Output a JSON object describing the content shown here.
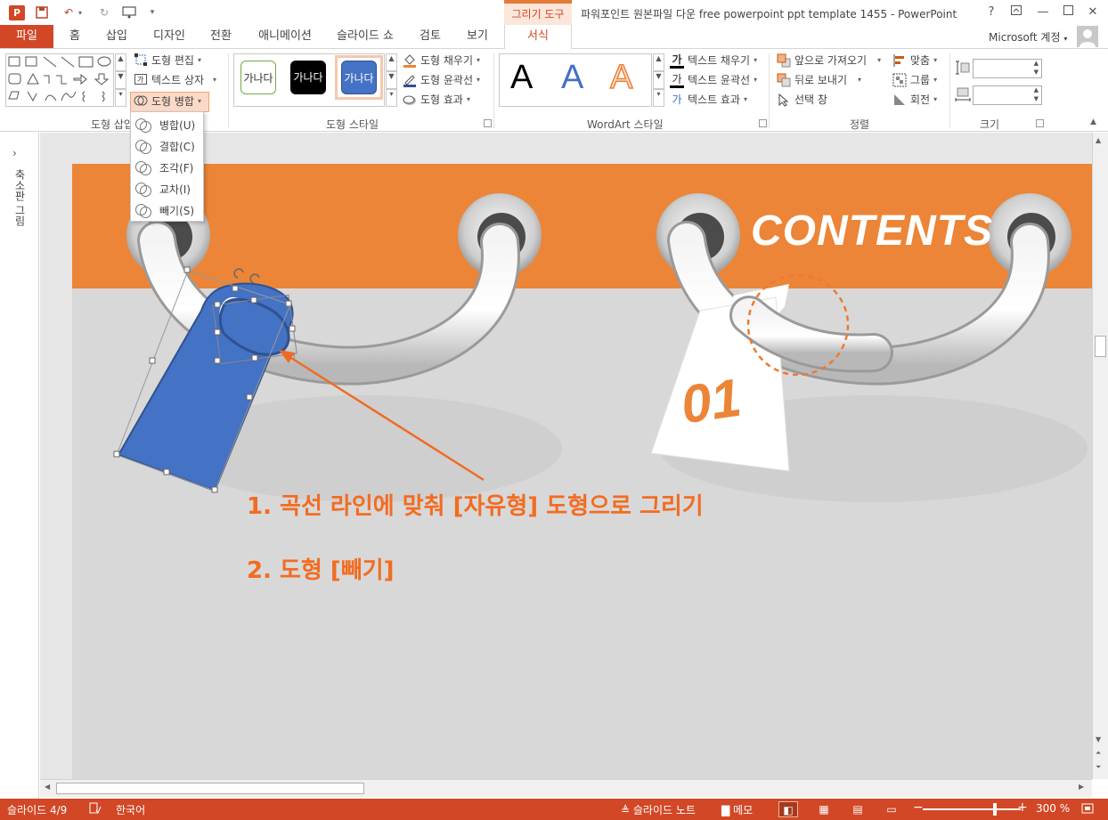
{
  "window": {
    "title": "파워포인트 원본파일 다운 free powerpoint ppt template 1455 - PowerPoint",
    "contextual_group": "그리기 도구",
    "help": "?",
    "account": "Microsoft 계정"
  },
  "tabs": {
    "file": "파일",
    "items": [
      "홈",
      "삽입",
      "디자인",
      "전환",
      "애니메이션",
      "슬라이드 쇼",
      "검토",
      "보기"
    ],
    "format": "서식"
  },
  "ribbon": {
    "insert_shapes": {
      "label": "도형 삽입",
      "edit_shape": "도형 편집",
      "text_box": "텍스트 상자",
      "merge_shapes": "도형 병합"
    },
    "shape_styles": {
      "label": "도형 스타일",
      "samples": [
        "가나다",
        "가나다",
        "가나다"
      ],
      "fill": "도형 채우기",
      "outline": "도형 윤곽선",
      "effects": "도형 효과"
    },
    "wordart": {
      "label": "WordArt 스타일",
      "samples": [
        "A",
        "A",
        "A"
      ],
      "text_fill": "텍스트 채우기",
      "text_outline": "텍스트 윤곽선",
      "text_effects": "텍스트 효과"
    },
    "arrange": {
      "label": "정렬",
      "bring_forward": "앞으로 가져오기",
      "send_backward": "뒤로 보내기",
      "selection_pane": "선택 창",
      "align": "맞춤",
      "group": "그룹",
      "rotate": "회전"
    },
    "size": {
      "label": "크기"
    }
  },
  "merge_menu": {
    "items": [
      "병합(U)",
      "결합(C)",
      "조각(F)",
      "교차(I)",
      "빼기(S)"
    ]
  },
  "thumbnails_pane": {
    "label": "축소판 그림"
  },
  "slide": {
    "title": "CONTENTS",
    "tag_number": "01",
    "annotation_1": "1. 곡선 라인에 맞춰 [자유형] 도형으로 그리기",
    "annotation_2": "2. 도형 [빼기]"
  },
  "statusbar": {
    "slide_counter": "슬라이드 4/9",
    "language": "한국어",
    "notes": "슬라이드 노트",
    "comments": "메모",
    "zoom": "300 %"
  },
  "colors": {
    "accent": "#d24726",
    "slide_orange": "#ec8537",
    "annotation": "#f36c21",
    "shape_blue": "#4472c4"
  }
}
